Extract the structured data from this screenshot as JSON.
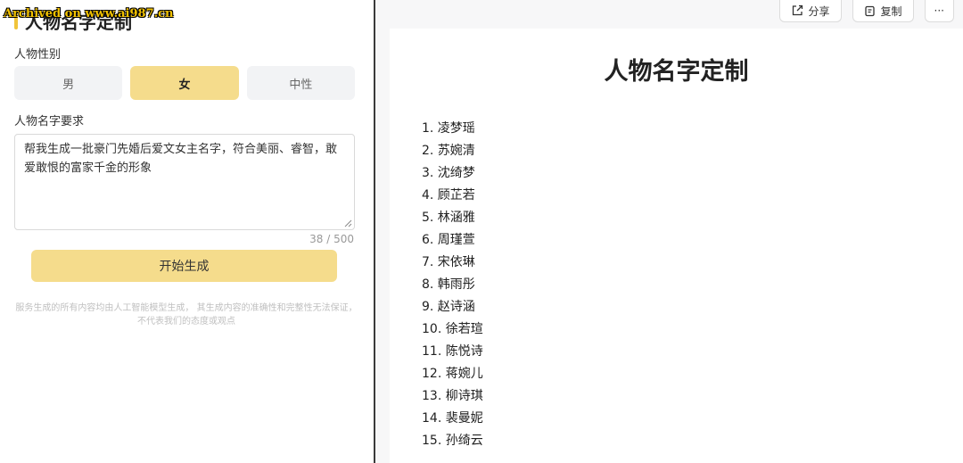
{
  "watermark": "Archived on www.ai987.cn",
  "form": {
    "section_title": "人物名字定制",
    "gender_label": "人物性别",
    "gender_options": [
      "男",
      "女",
      "中性"
    ],
    "gender_selected": "女",
    "requirement_label": "人物名字要求",
    "requirement_text": "帮我生成一批豪门先婚后爱文女主名字，符合美丽、睿智，敢爱敢恨的富家千金的形象",
    "counter": "38 / 500",
    "generate_button": "开始生成",
    "disclaimer": "服务生成的所有内容均由人工智能模型生成， 其生成内容的准确性和完整性无法保证， 不代表我们的态度或观点"
  },
  "toolbar": {
    "share_label": "分享",
    "copy_label": "复制",
    "more_label": "···"
  },
  "result": {
    "title": "人物名字定制",
    "names": [
      "1. 凌梦瑶",
      "2. 苏婉清",
      "3. 沈绮梦",
      "4. 顾芷若",
      "5. 林涵雅",
      "6. 周瑾萱",
      "7. 宋依琳",
      "8. 韩雨彤",
      "9. 赵诗涵",
      "10. 徐若瑄",
      "11. 陈悦诗",
      "12. 蒋婉儿",
      "13. 柳诗琪",
      "14. 裴曼妮",
      "15. 孙绮云"
    ]
  },
  "colors": {
    "accent": "#f5dc8c",
    "accent_bar": "#f0c43a"
  }
}
